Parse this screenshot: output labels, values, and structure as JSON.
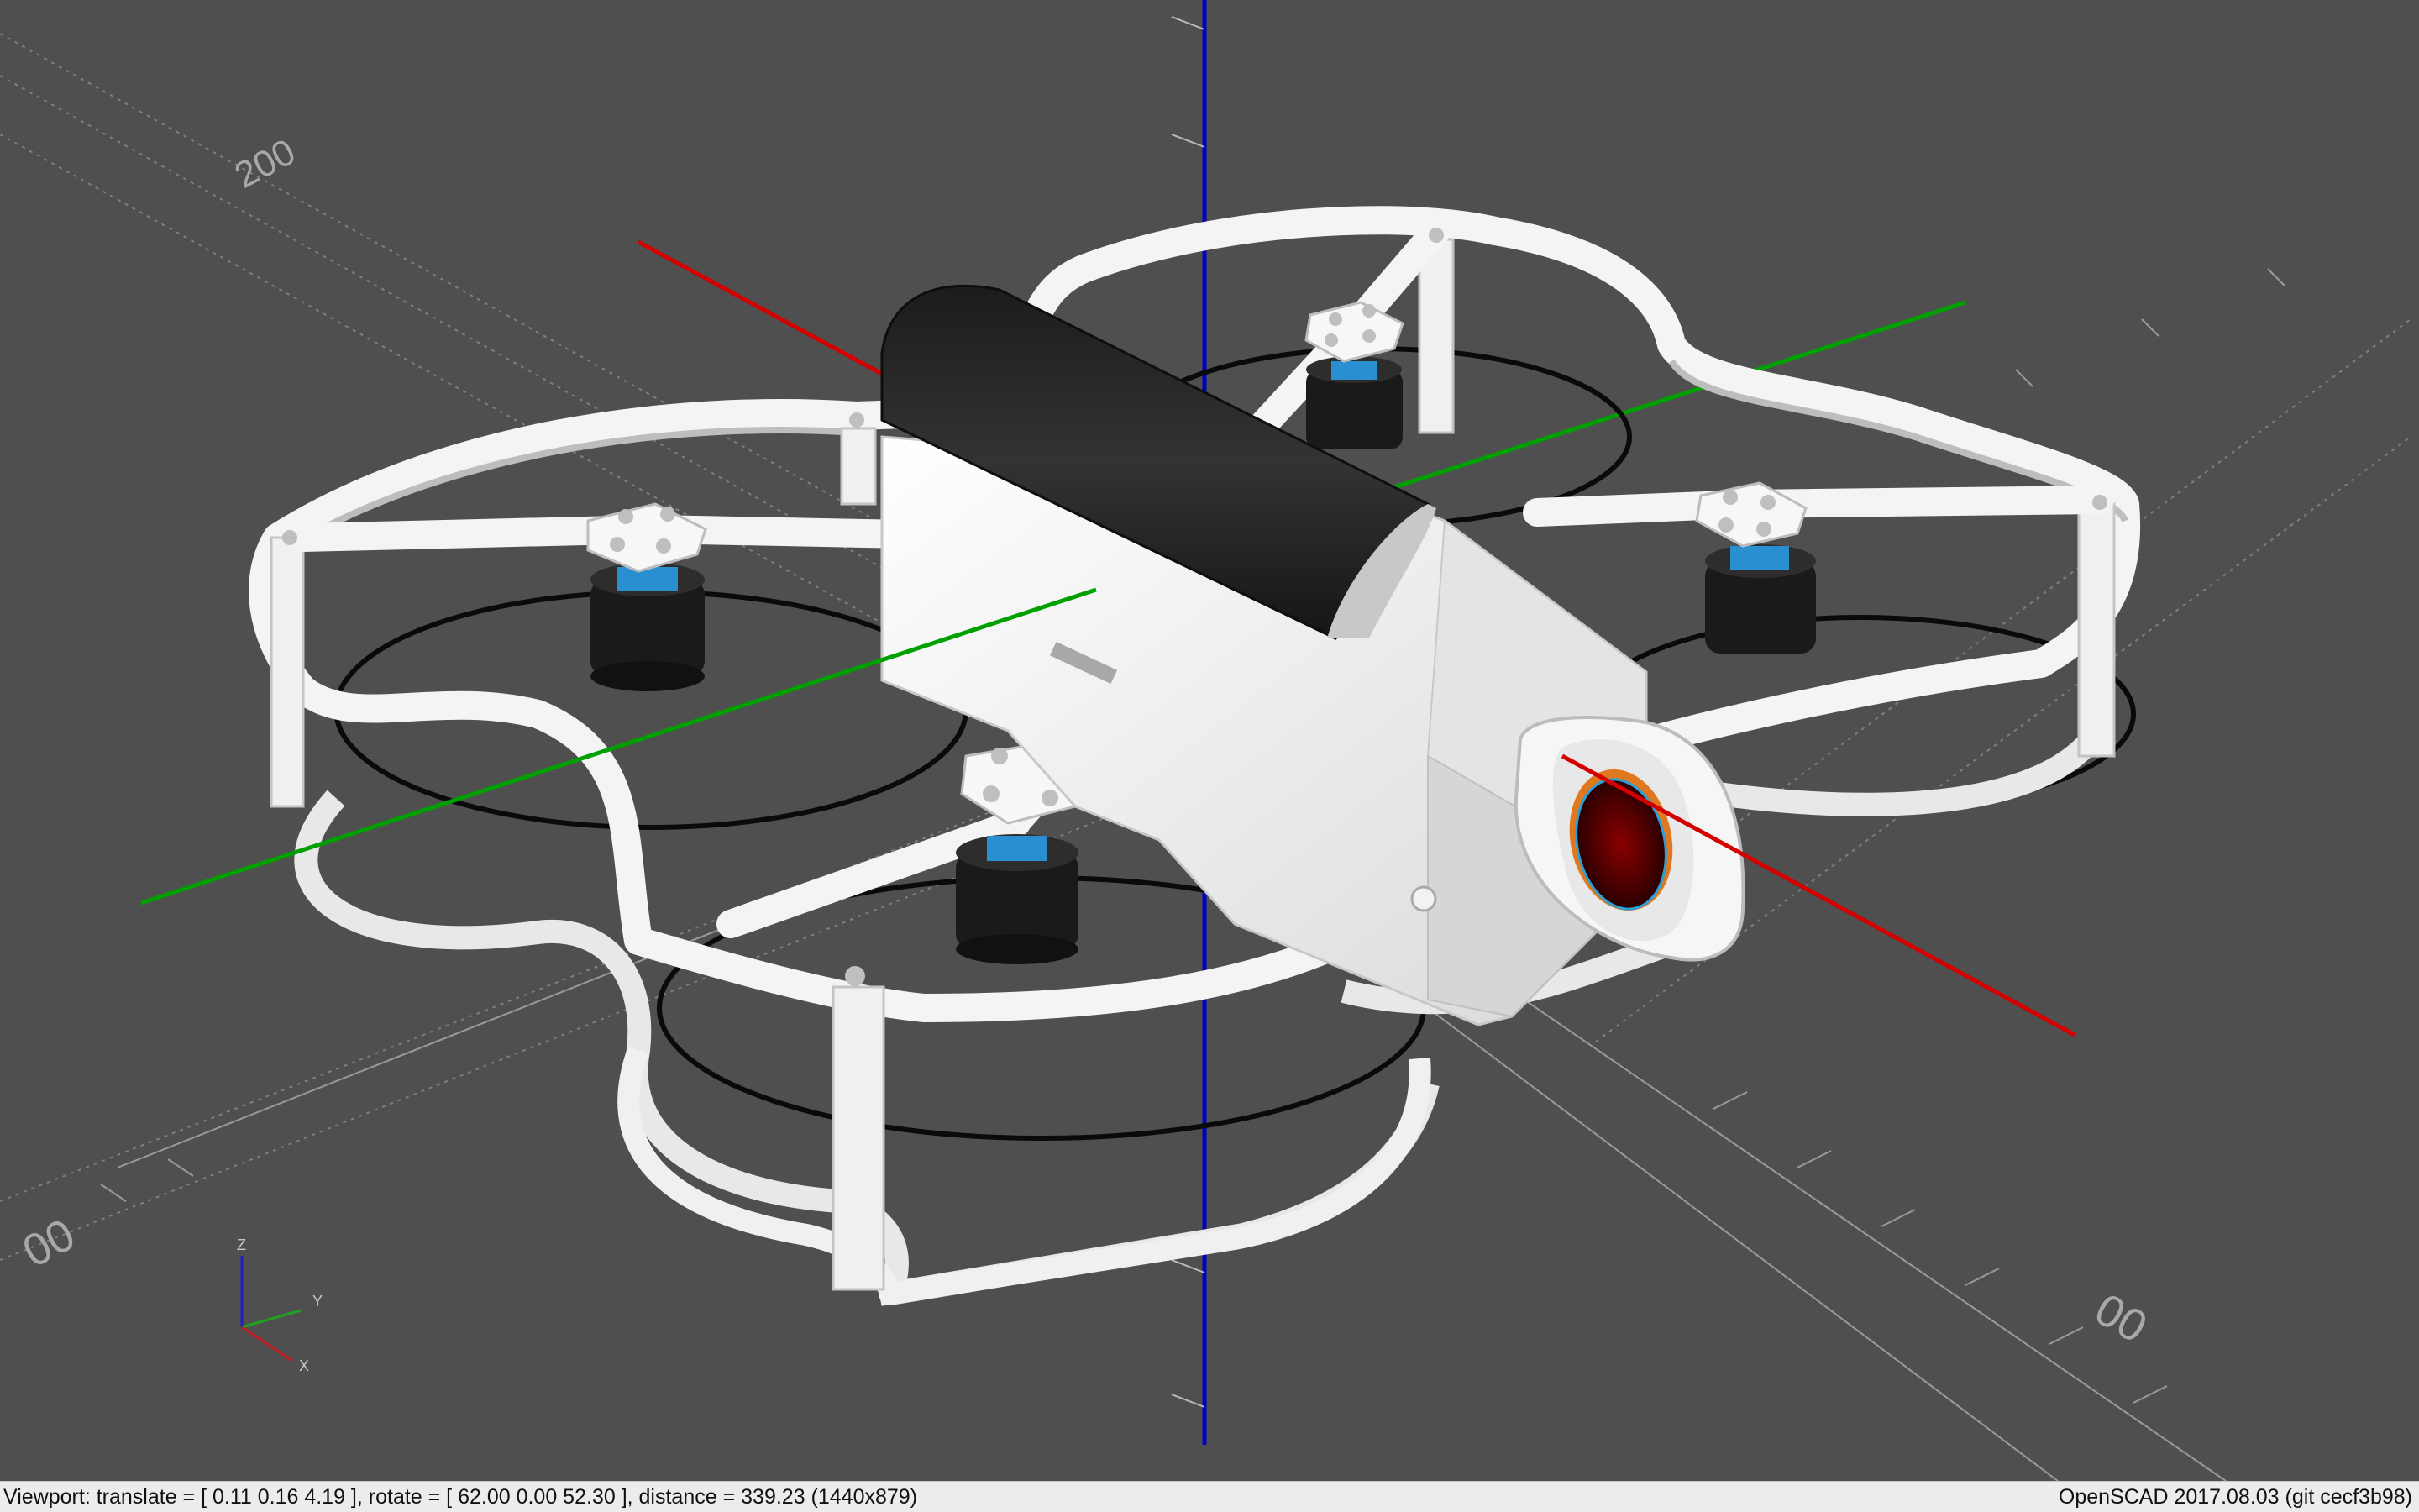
{
  "app": {
    "name": "OpenSCAD",
    "version_label": "OpenSCAD 2017.08.03 (git cecf3b98)"
  },
  "status_bar": {
    "viewport_info": "Viewport: translate = [ 0.11 0.16 4.19 ], rotate = [ 62.00 0.00 52.30 ], distance = 339.23 (1440x879)"
  },
  "axes_gizmo": {
    "x_label": "X",
    "y_label": "Y",
    "z_label": "Z"
  },
  "scale_markers": {
    "top_left": "200",
    "bottom_left": "00",
    "bottom_right": "00"
  },
  "colors": {
    "background": "#4f4f4f",
    "x_axis": "#d40000",
    "y_axis": "#00a000",
    "z_axis": "#0000c0",
    "frame": "#f2f2f2",
    "battery": "#262626",
    "motor": "#161616",
    "bearing": "#2a8fd0",
    "lens": "#5a0000",
    "lens_ring": "#e07820"
  },
  "model": {
    "description_icon": "drone-frame-model",
    "motors": 4,
    "propeller_guards": 4
  }
}
